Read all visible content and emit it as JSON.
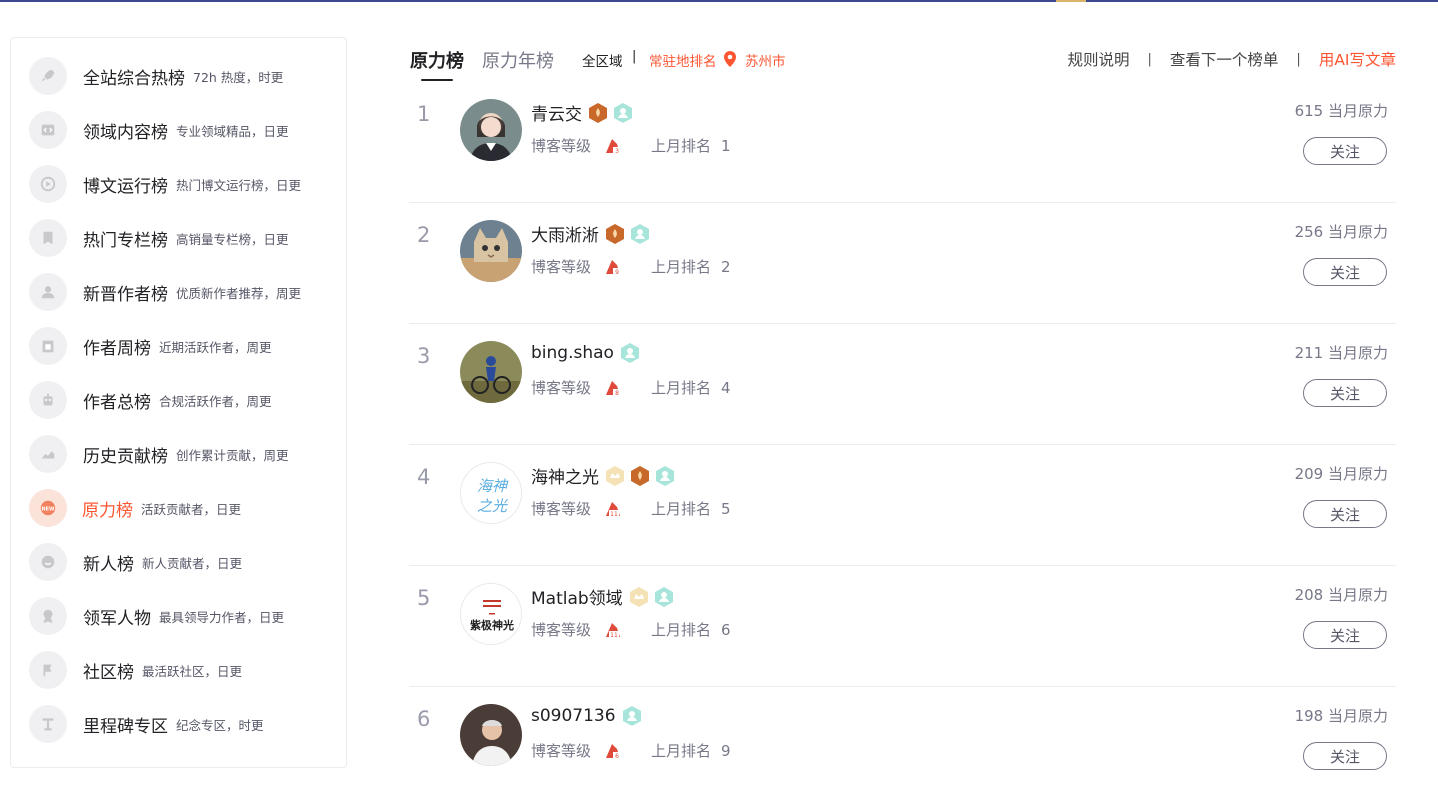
{
  "sidebar": {
    "items": [
      {
        "name": "全站综合热榜",
        "desc": "72h 热度，时更",
        "icon": "rocket-icon"
      },
      {
        "name": "领域内容榜",
        "desc": "专业领域精品，日更",
        "icon": "code-icon"
      },
      {
        "name": "博文运行榜",
        "desc": "热门博文运行榜，日更",
        "icon": "play-icon"
      },
      {
        "name": "热门专栏榜",
        "desc": "高销量专栏榜，日更",
        "icon": "book-icon"
      },
      {
        "name": "新晋作者榜",
        "desc": "优质新作者推荐，周更",
        "icon": "user-icon"
      },
      {
        "name": "作者周榜",
        "desc": "近期活跃作者，周更",
        "icon": "calendar-icon"
      },
      {
        "name": "作者总榜",
        "desc": "合规活跃作者，周更",
        "icon": "robot-icon"
      },
      {
        "name": "历史贡献榜",
        "desc": "创作累计贡献，周更",
        "icon": "hand-icon"
      },
      {
        "name": "原力榜",
        "desc": "活跃贡献者，日更",
        "icon": "new-badge-icon",
        "active": true
      },
      {
        "name": "新人榜",
        "desc": "新人贡献者，日更",
        "icon": "smile-icon"
      },
      {
        "name": "领军人物",
        "desc": "最具领导力作者，日更",
        "icon": "medal-icon"
      },
      {
        "name": "社区榜",
        "desc": "最活跃社区，日更",
        "icon": "flag-icon"
      },
      {
        "name": "里程碑专区",
        "desc": "纪念专区，时更",
        "icon": "milestone-icon"
      }
    ]
  },
  "header": {
    "tab_main": "原力榜",
    "tab_year": "原力年榜",
    "region": "全区域",
    "region_sep": "|",
    "resident_rank": "常驻地排名",
    "city": "苏州市",
    "link_rules": "规则说明",
    "link_next": "查看下一个榜单",
    "link_ai": "用AI写文章",
    "sep": "|"
  },
  "labels": {
    "level": "博客等级",
    "last_month": "上月排名",
    "power_suffix": "当月原力",
    "follow": "关注"
  },
  "rows": [
    {
      "rank": "1",
      "name": "青云交",
      "last": "1",
      "power": "615",
      "badges": [
        "bronze-badge-icon",
        "teal-badge-icon"
      ],
      "level_icon": "level-3-icon",
      "avatar": "photo-woman-avatar"
    },
    {
      "rank": "2",
      "name": "大雨淅淅",
      "last": "2",
      "power": "256",
      "badges": [
        "bronze-badge-icon",
        "teal-badge-icon"
      ],
      "level_icon": "level-9-icon",
      "avatar": "photo-cat-avatar"
    },
    {
      "rank": "3",
      "name": "bing.shao",
      "last": "4",
      "power": "211",
      "badges": [
        "teal-badge-icon"
      ],
      "level_icon": "level-8-icon",
      "avatar": "photo-cyclist-avatar"
    },
    {
      "rank": "4",
      "name": "海神之光",
      "last": "5",
      "power": "209",
      "badges": [
        "gold-badge-icon",
        "bronze-badge-icon",
        "teal-badge-icon"
      ],
      "level_icon": "level-11-icon",
      "avatar": "text-logo-avatar",
      "avatar_text": [
        "海神",
        "之光"
      ]
    },
    {
      "rank": "5",
      "name": "Matlab领域",
      "last": "6",
      "power": "208",
      "badges": [
        "gold-badge-icon",
        "teal-badge-icon"
      ],
      "level_icon": "level-11-icon",
      "avatar": "text-logo-avatar",
      "avatar_text": [
        "紫极神光"
      ]
    },
    {
      "rank": "6",
      "name": "s0907136",
      "last": "9",
      "power": "198",
      "badges": [
        "teal-badge-icon"
      ],
      "level_icon": "level-6-icon",
      "avatar": "photo-man-avatar"
    }
  ],
  "colors": {
    "accent": "#fc5531",
    "muted": "#777888",
    "teal": "#56c8b4",
    "bronze": "#c8682a",
    "gold": "#e8c77a"
  }
}
